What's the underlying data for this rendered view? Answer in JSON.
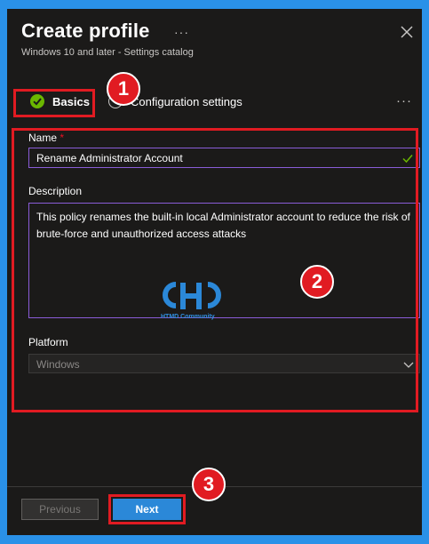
{
  "header": {
    "title": "Create profile",
    "subtitle": "Windows 10 and later - Settings catalog",
    "more_icon": "ellipsis-icon",
    "close_icon": "close-icon"
  },
  "tabs": [
    {
      "label": "Basics",
      "state": "complete"
    },
    {
      "label": "Configuration settings",
      "state": "pending"
    }
  ],
  "form": {
    "name_label": "Name",
    "required_marker": "*",
    "name_value": "Rename Administrator Account",
    "description_label": "Description",
    "description_value": "This policy renames the built-in local Administrator account to reduce the risk of brute-force and unauthorized access attacks",
    "platform_label": "Platform",
    "platform_value": "Windows"
  },
  "watermark": {
    "text": "HTMD Community"
  },
  "footer": {
    "previous_label": "Previous",
    "next_label": "Next"
  },
  "markers": [
    "1",
    "2",
    "3"
  ],
  "colors": {
    "accent": "#2b88d8",
    "highlight": "#e11b22",
    "success": "#6bb700",
    "input_focus_border": "#8a5cd8",
    "panel_bg": "#1b1a19",
    "page_bg": "#2a91e8"
  }
}
